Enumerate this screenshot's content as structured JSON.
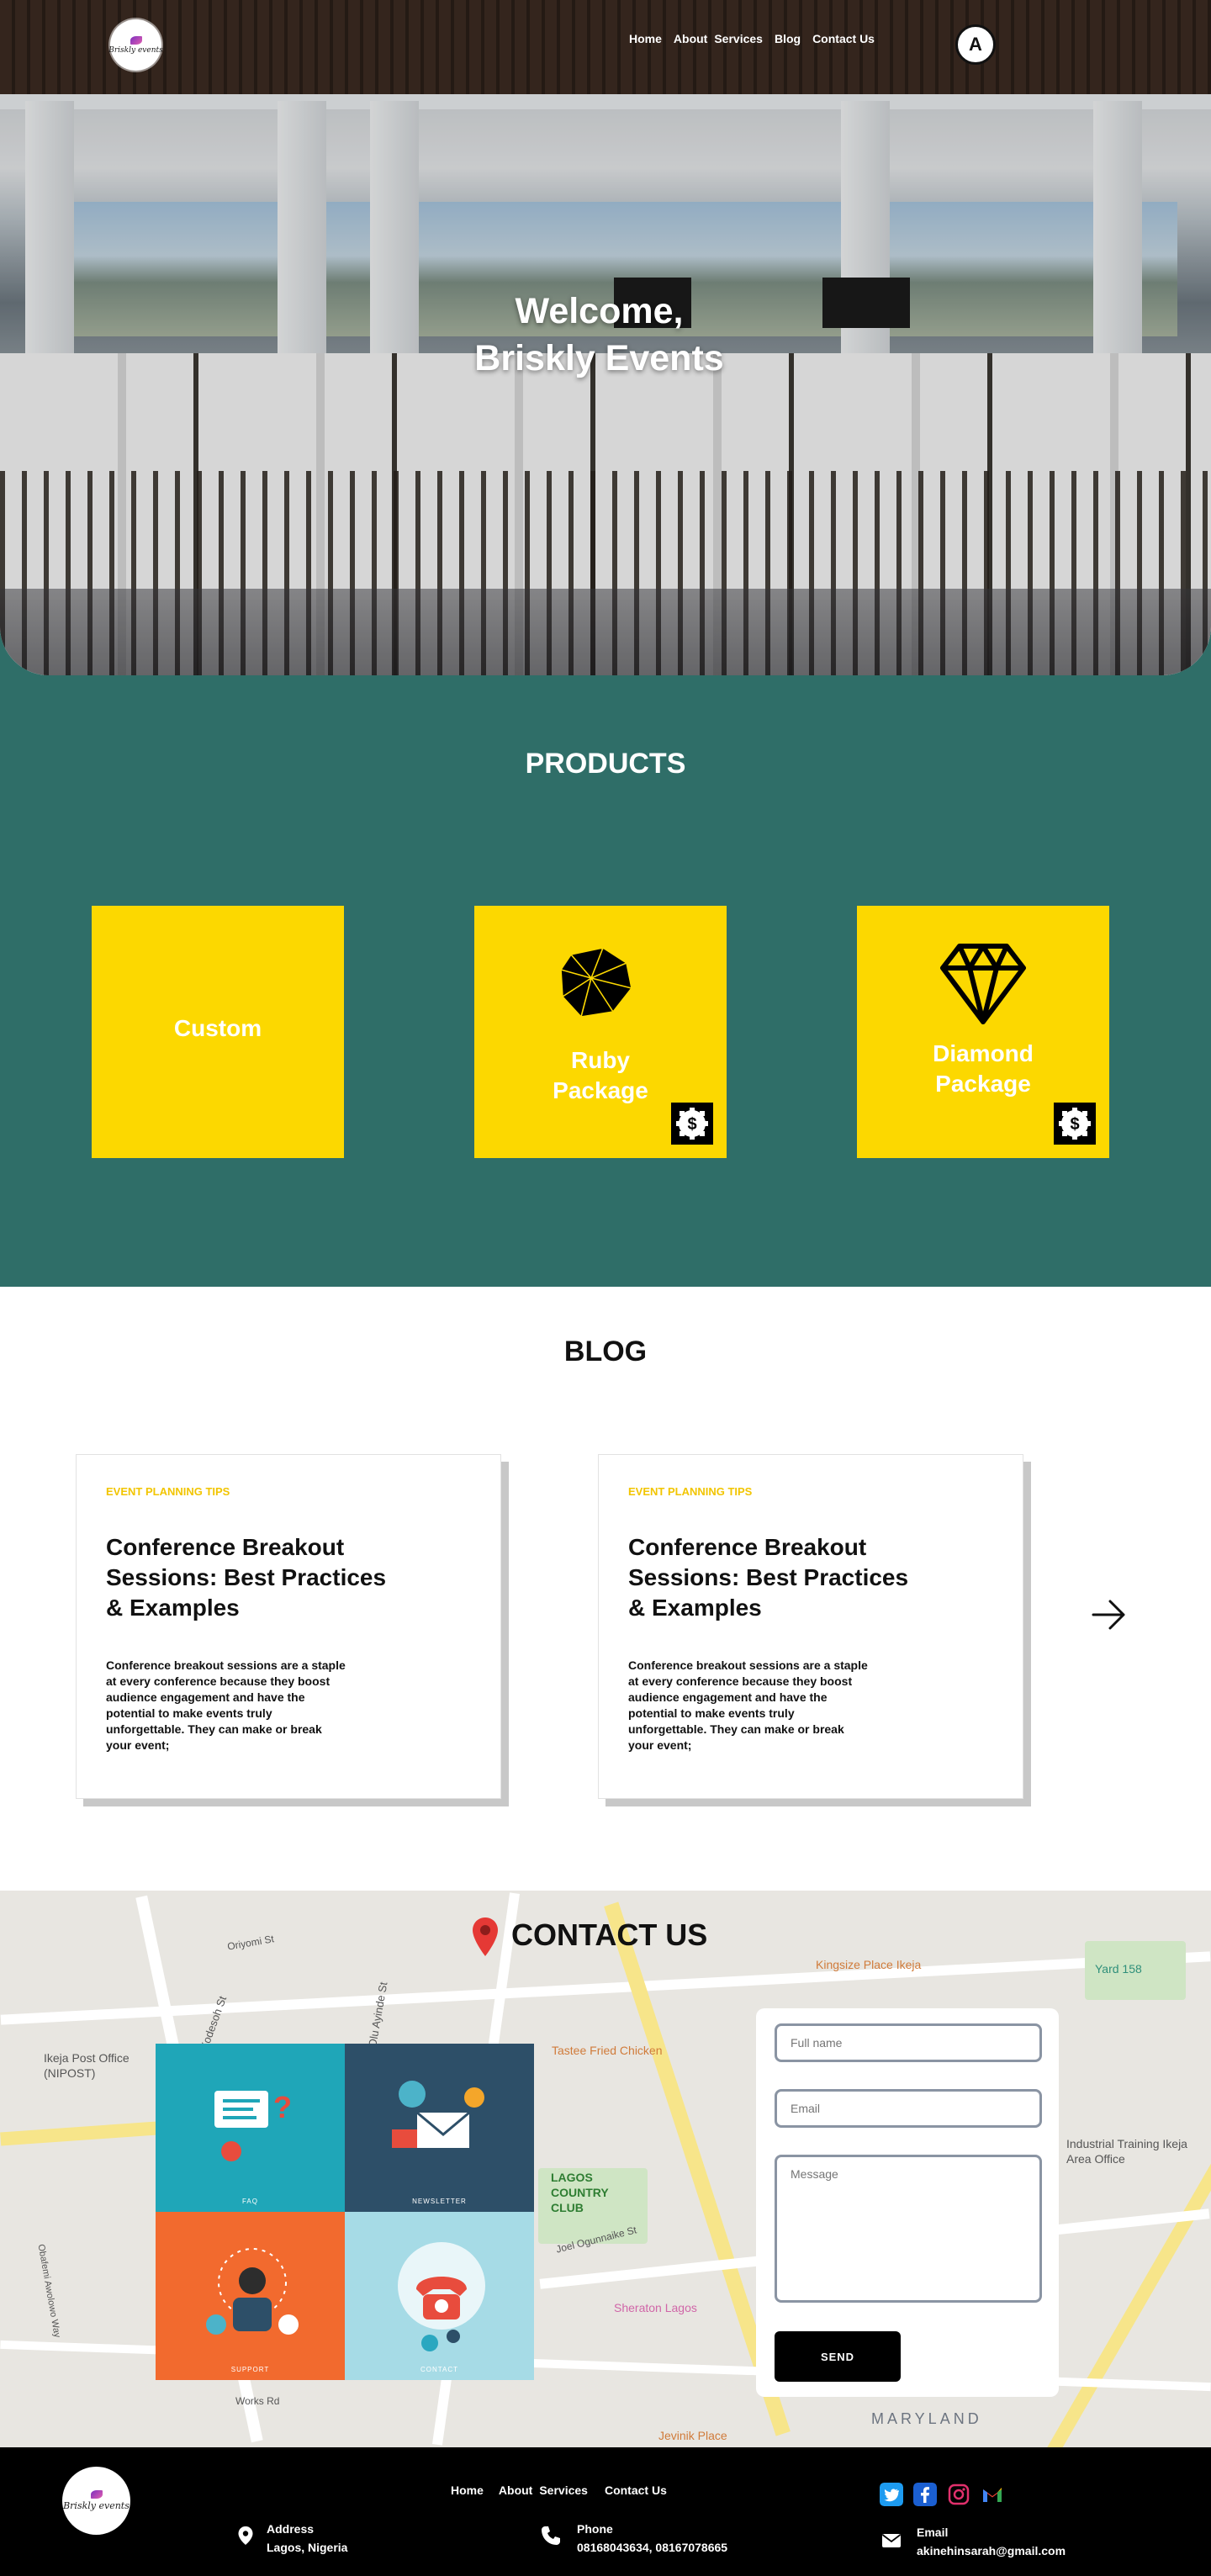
{
  "brand": {
    "logo_text": "Briskly events"
  },
  "nav": {
    "items": [
      "Home",
      "About",
      "Services",
      "Blog",
      "Contact Us"
    ]
  },
  "accessibility": {
    "label": "A"
  },
  "hero": {
    "title_line1": "Welcome,",
    "title_line2": "Briskly Events"
  },
  "products": {
    "title": "PRODUCTS",
    "cards": [
      {
        "label": "Custom",
        "icon": "none"
      },
      {
        "label_line1": "Ruby",
        "label_line2": "Package",
        "icon": "ruby-icon"
      },
      {
        "label_line1": "Diamond",
        "label_line2": "Package",
        "icon": "diamond-icon"
      }
    ],
    "colors": {
      "background": "#2f6e68",
      "card": "#fcd800"
    }
  },
  "blog": {
    "title": "BLOG",
    "posts": [
      {
        "tag": "EVENT PLANNING TIPS",
        "title": "Conference Breakout Sessions: Best Practices & Examples",
        "excerpt": "Conference breakout sessions are a staple at every conference because they boost audience engagement and have the potential to make events truly unforgettable. They can make or break your event;"
      },
      {
        "tag": "EVENT PLANNING TIPS",
        "title": "Conference Breakout Sessions: Best Practices & Examples",
        "excerpt": "Conference breakout sessions are a staple at every conference because they boost audience engagement and have the potential to make events truly unforgettable. They can make or break your event;"
      }
    ]
  },
  "contact": {
    "title": "CONTACT US",
    "form": {
      "name_placeholder": "Full name",
      "email_placeholder": "Email",
      "message_placeholder": "Message",
      "send_label": "SEND"
    },
    "illustration_captions": [
      "FAQ",
      "NEWSLETTER",
      "SUPPORT",
      "CONTACT"
    ],
    "map_labels": [
      "Kingsize Place Ikeja",
      "Yard 158",
      "Ikeja Post Office (NIPOST)",
      "Tastee Fried Chicken",
      "LAGOS COUNTRY CLUB",
      "Industrial Training Ikeja Area Office",
      "Sheraton Lagos",
      "Jevinik Place",
      "MARYLAND",
      "Obafemi Awolowo Way",
      "Joel Ogunnaike St",
      "Oriyomi St",
      "Kodesoh St",
      "Olu Ayinde St",
      "Works Rd"
    ]
  },
  "footer": {
    "nav": [
      "Home",
      "About",
      "Services",
      "Contact Us"
    ],
    "address_label": "Address",
    "address_value": "Lagos, Nigeria",
    "phone_label": "Phone",
    "phone_value": "08168043634, 08167078665",
    "email_label": "Email",
    "email_value": "akinehinsarah@gmail.com",
    "social": [
      "twitter-icon",
      "facebook-icon",
      "instagram-icon",
      "gmail-icon"
    ]
  }
}
